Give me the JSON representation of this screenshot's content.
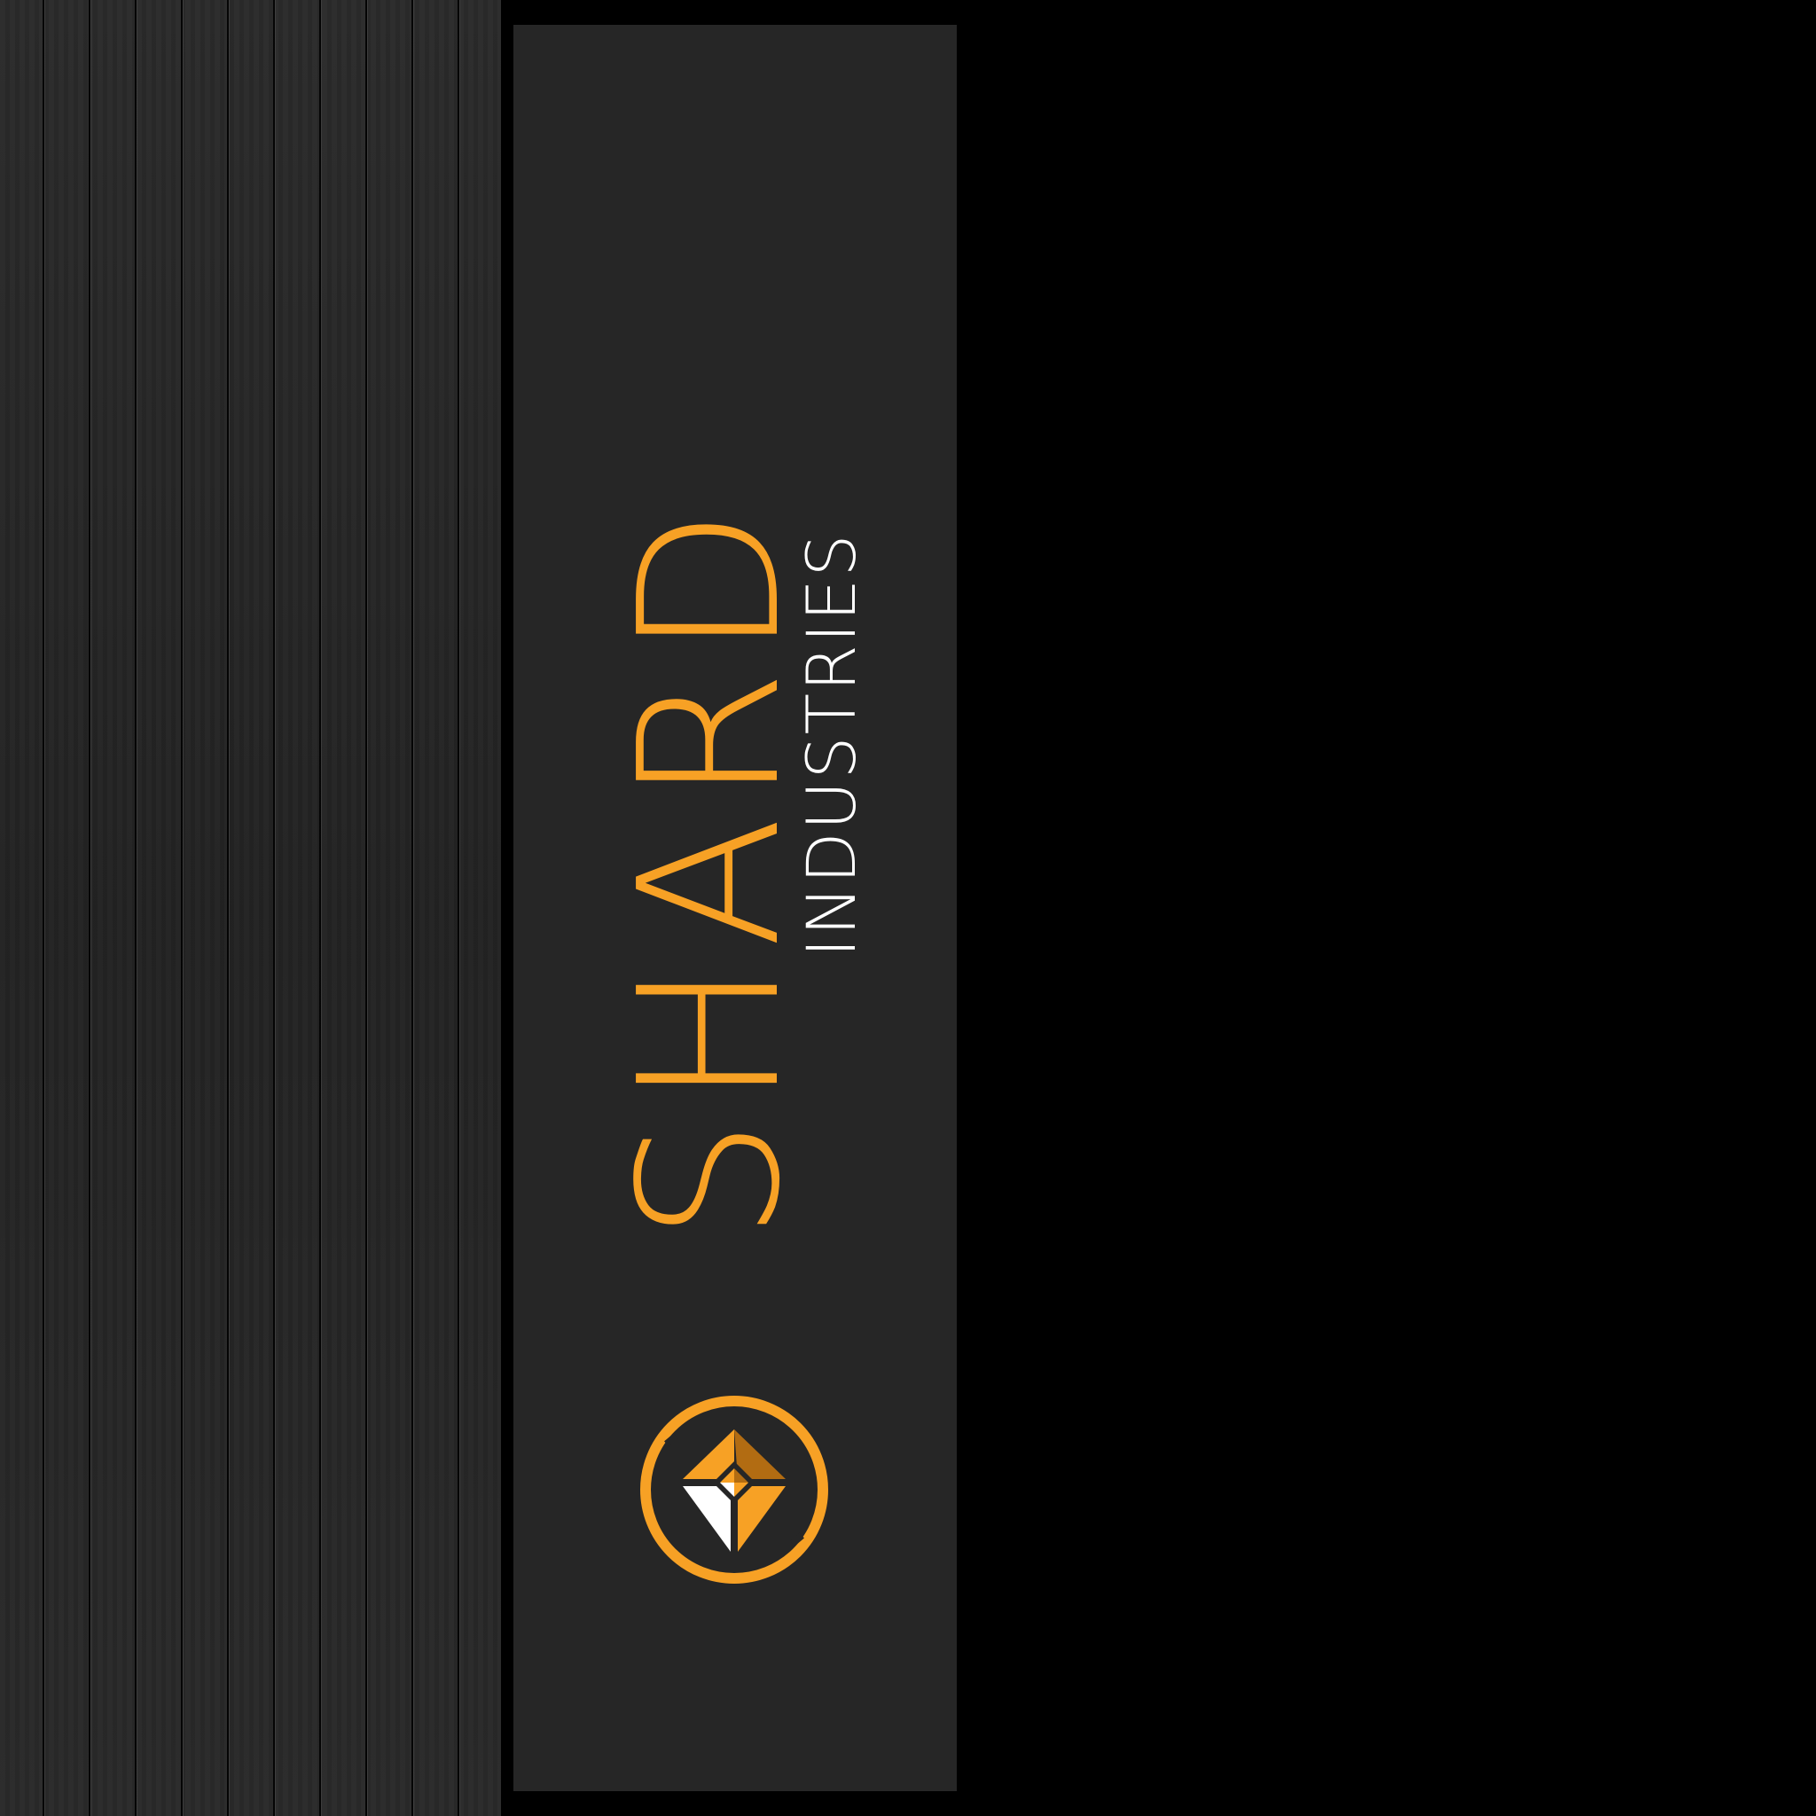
{
  "brand": {
    "name": "SHARD",
    "tagline": "INDUSTRIES",
    "emblem_icon": "diamond-shard-emblem-icon"
  },
  "colors": {
    "accent": "#f7a125",
    "accent_dark": "#b26c12",
    "text_light": "#ffffff",
    "card_background": "#262626",
    "page_background": "#000000"
  }
}
